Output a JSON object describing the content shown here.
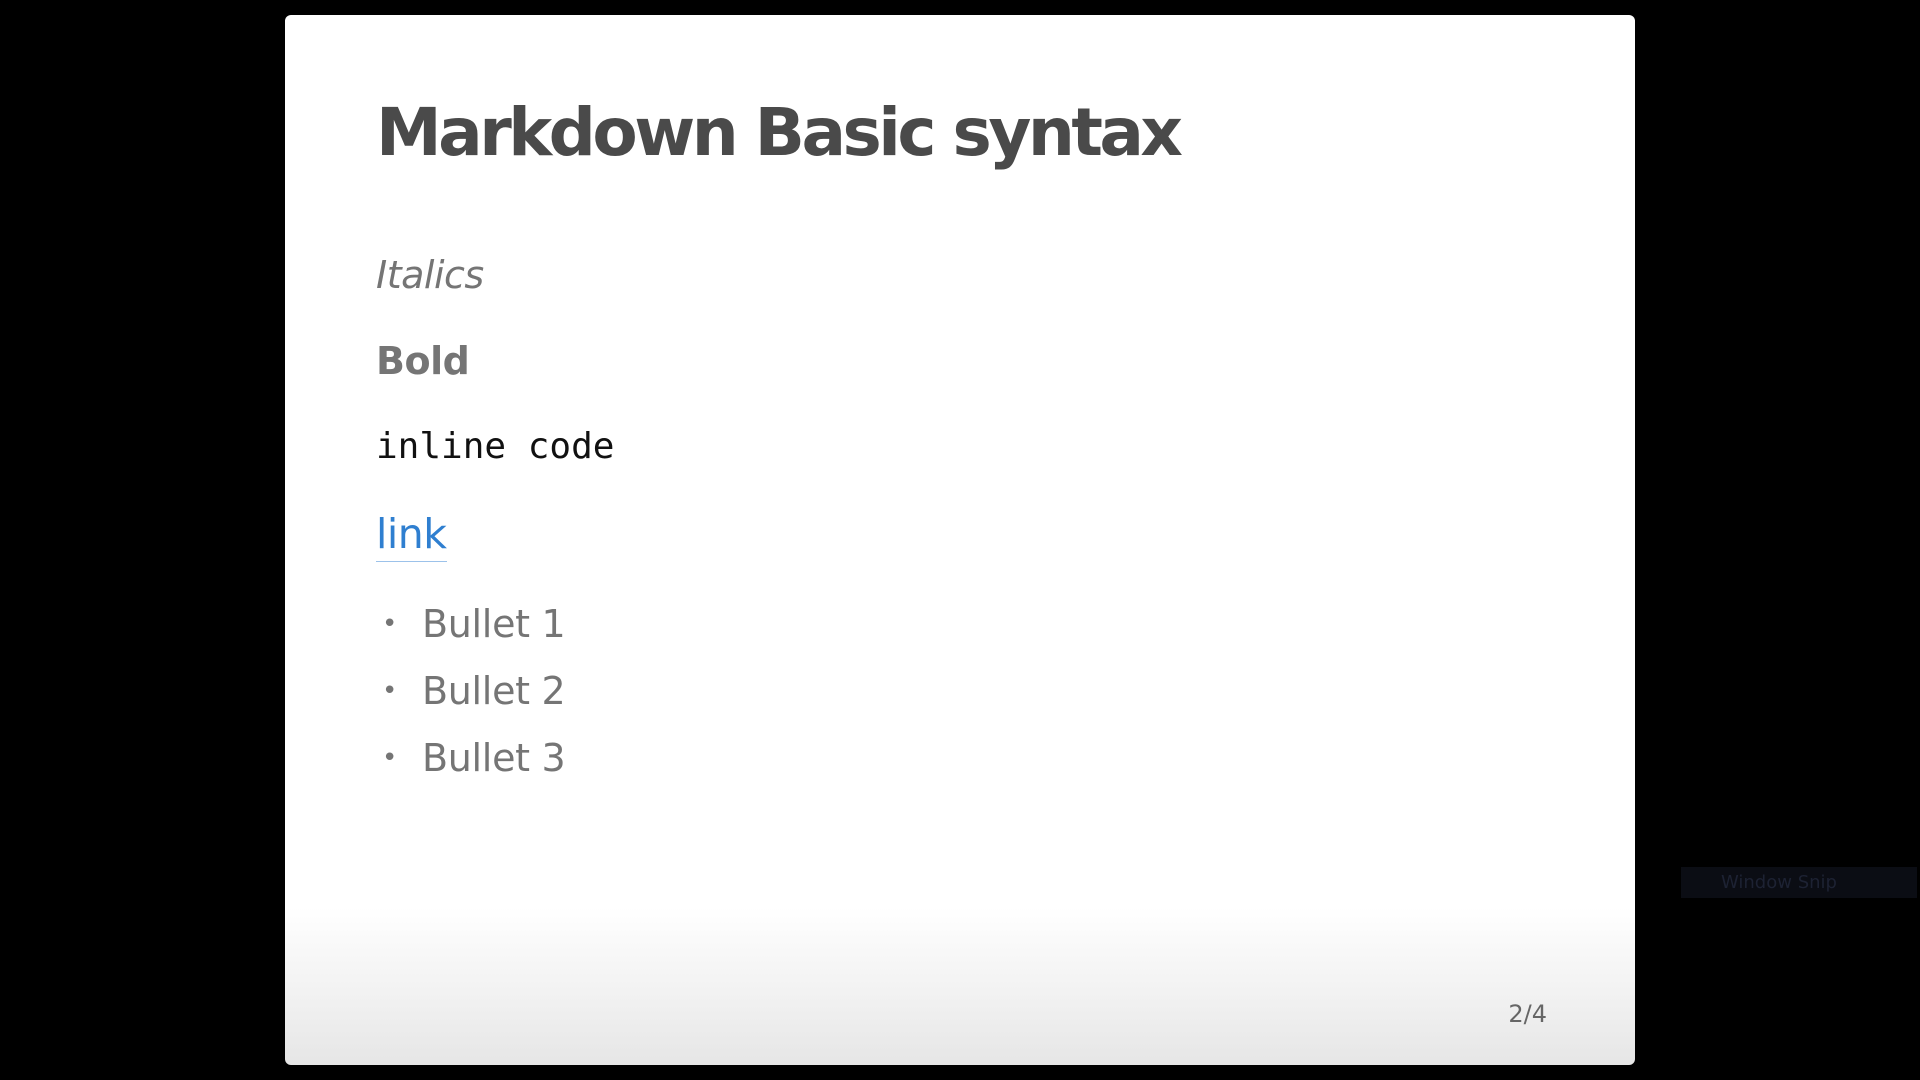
{
  "slide": {
    "title": "Markdown Basic syntax",
    "italic_text": "Italics",
    "bold_text": "Bold",
    "code_text": "inline code",
    "link_text": "link",
    "bullets": [
      {
        "label": "Bullet 1"
      },
      {
        "label": "Bullet 2"
      },
      {
        "label": "Bullet 3"
      }
    ],
    "bullet_glyph": "•",
    "page_indicator": "2/4"
  },
  "overlay": {
    "label": "Window Snip"
  },
  "colors": {
    "background": "#000000",
    "slide": "#ffffff",
    "title": "#4a4a4a",
    "text": "#757575",
    "link": "#2f7fd0"
  }
}
